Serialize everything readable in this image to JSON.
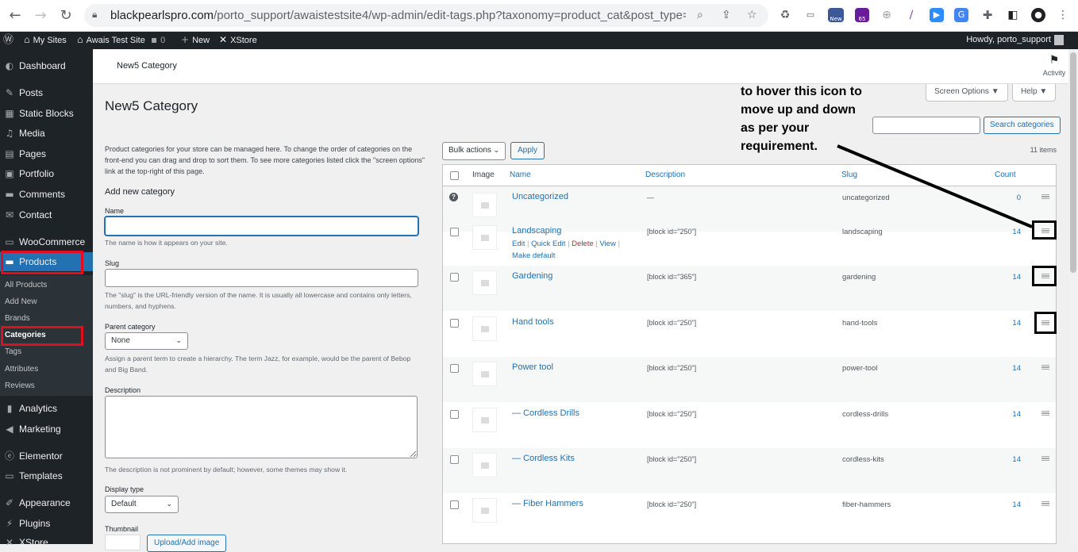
{
  "browser": {
    "url_host": "blackpearlspro.com",
    "url_path": "/porto_support/awaistestsite4/wp-admin/edit-tags.php?taxonomy=product_cat&post_type=pro...",
    "ext_badge_new": "New",
    "ext_badge_count": "65"
  },
  "adminbar": {
    "my_sites": "My Sites",
    "site_name": "Awais Test Site",
    "comments_count": "0",
    "new_label": "New",
    "xstore": "XStore",
    "howdy": "Howdy, porto_support"
  },
  "sidebar": {
    "items": {
      "dashboard": "Dashboard",
      "posts": "Posts",
      "static_blocks": "Static Blocks",
      "media": "Media",
      "pages": "Pages",
      "portfolio": "Portfolio",
      "comments": "Comments",
      "contact": "Contact",
      "woocommerce": "WooCommerce",
      "products": "Products",
      "analytics": "Analytics",
      "marketing": "Marketing",
      "elementor": "Elementor",
      "templates": "Templates",
      "appearance": "Appearance",
      "plugins": "Plugins",
      "xstore": "XStore"
    },
    "submenu": {
      "all_products": "All Products",
      "add_new": "Add New",
      "brands": "Brands",
      "categories": "Categories",
      "tags": "Tags",
      "attributes": "Attributes",
      "reviews": "Reviews"
    }
  },
  "header": {
    "title": "New5 Category",
    "activity": "Activity",
    "screen_options": "Screen Options ▼",
    "help": "Help ▼"
  },
  "page": {
    "title": "New5 Category",
    "annotation": [
      "to hover this icon to",
      "move up and down",
      "as per your",
      "requirement."
    ],
    "intro": "Product categories for your store can be managed here. To change the order of categories on the front-end you can drag and drop to sort them. To see more categories listed click the \"screen options\" link at the top-right of this page."
  },
  "form": {
    "heading": "Add new category",
    "name_label": "Name",
    "name_help": "The name is how it appears on your site.",
    "slug_label": "Slug",
    "slug_help": "The \"slug\" is the URL-friendly version of the name. It is usually all lowercase and contains only letters, numbers, and hyphens.",
    "parent_label": "Parent category",
    "parent_value": "None",
    "parent_help": "Assign a parent term to create a hierarchy. The term Jazz, for example, would be the parent of Bebop and Big Band.",
    "description_label": "Description",
    "description_help": "The description is not prominent by default; however, some themes may show it.",
    "display_label": "Display type",
    "display_value": "Default",
    "thumbnail_label": "Thumbnail",
    "upload_button": "Upload/Add image"
  },
  "list": {
    "bulk_actions": "Bulk actions",
    "apply": "Apply",
    "search_button": "Search categories",
    "items_count": "11 items",
    "columns": {
      "image": "Image",
      "name": "Name",
      "description": "Description",
      "slug": "Slug",
      "count": "Count"
    },
    "row_actions": {
      "edit": "Edit",
      "quick_edit": "Quick Edit",
      "delete": "Delete",
      "view": "View",
      "make_default": "Make default"
    },
    "rows": [
      {
        "name": "Uncategorized",
        "description": "—",
        "slug": "uncategorized",
        "count": "0"
      },
      {
        "name": "Landscaping",
        "description": "[block id=\"250\"]",
        "slug": "landscaping",
        "count": "14"
      },
      {
        "name": "Gardening",
        "description": "[block id=\"365\"]",
        "slug": "gardening",
        "count": "14"
      },
      {
        "name": "Hand tools",
        "description": "[block id=\"250\"]",
        "slug": "hand-tools",
        "count": "14"
      },
      {
        "name": "Power tool",
        "description": "[block id=\"250\"]",
        "slug": "power-tool",
        "count": "14"
      },
      {
        "name": "— Cordless Drills",
        "description": "[block id=\"250\"]",
        "slug": "cordless-drills",
        "count": "14"
      },
      {
        "name": "— Cordless Kits",
        "description": "[block id=\"250\"]",
        "slug": "cordless-kits",
        "count": "14"
      },
      {
        "name": "— Fiber Hammers",
        "description": "[block id=\"250\"]",
        "slug": "fiber-hammers",
        "count": "14"
      }
    ]
  }
}
